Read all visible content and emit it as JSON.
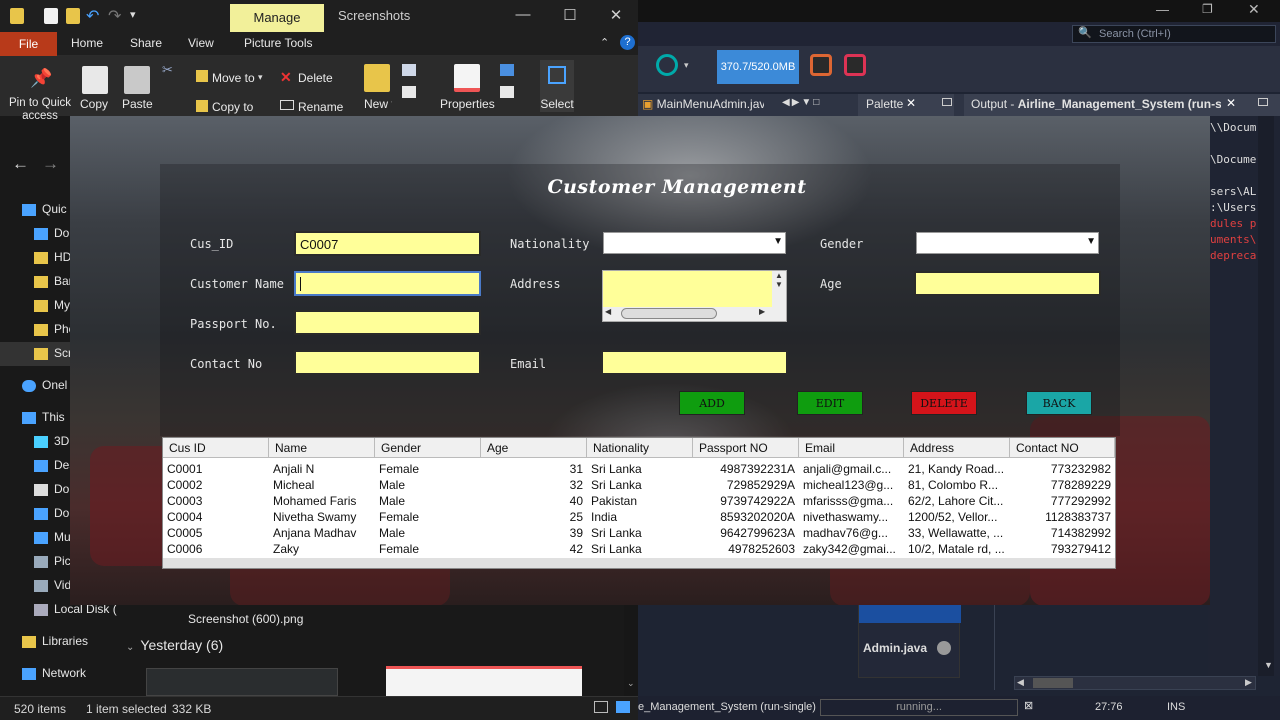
{
  "explorer": {
    "manage_tab": "Manage",
    "title": "Screenshots",
    "ribbon_tabs": [
      "File",
      "Home",
      "Share",
      "View",
      "Picture Tools"
    ],
    "ribbon": {
      "pin": "Pin to Quick access",
      "copy": "Copy",
      "paste": "Paste",
      "move_to": "Move to",
      "delete": "Delete",
      "copy_to": "Copy to",
      "rename": "Rename",
      "new_folder": "New folder",
      "properties": "Properties",
      "select": "Select"
    },
    "nav_items": [
      "Quic",
      "Do",
      "HD",
      "Bar",
      "My",
      "Pho",
      "Scr",
      "Onel",
      "This",
      "3D",
      "Des",
      "Do",
      "Do",
      "Mu",
      "Pic",
      "Vid",
      "Local Disk ("
    ],
    "libraries": "Libraries",
    "network": "Network",
    "file_name": "Screenshot (600).png",
    "group_yesterday": "Yesterday (6)",
    "status": {
      "items": "520 items",
      "selected": "1 item selected",
      "size": "332 KB"
    }
  },
  "ide": {
    "search_placeholder": "Search (Ctrl+I)",
    "memory": "370.7/520.0MB",
    "tab_file": "MainMenuAdmin.java...",
    "tab_palette": "Palette",
    "tab_output_prefix": "Output - ",
    "tab_output_name": "Airline_Management_System (run-s...",
    "output_lines": [
      "\\\\Docum",
      "\\Docume",
      "sers\\AL",
      ":\\Users",
      "dules p",
      "uments\\",
      "depreca"
    ],
    "palette_item": "Admin.java",
    "status_task": "e_Management_System (run-single)",
    "status_running": "running...",
    "status_pos": "27:76",
    "status_mode": "INS"
  },
  "cm": {
    "title": "Customer Management",
    "labels": {
      "cus_id": "Cus_ID",
      "customer_name": "Customer Name",
      "passport": "Passport No.",
      "contact": "Contact No",
      "nationality": "Nationality",
      "address": "Address",
      "email": "Email",
      "gender": "Gender",
      "age": "Age"
    },
    "values": {
      "cus_id": "C0007"
    },
    "buttons": {
      "add": "ADD",
      "edit": "EDIT",
      "delete": "DELETE",
      "back": "BACK"
    },
    "colors": {
      "add": "#0f9d0f",
      "edit": "#0f9d0f",
      "delete": "#d4141a",
      "back": "#1aa6a6",
      "field": "#ffff99"
    },
    "table": {
      "headers": [
        "Cus ID",
        "Name",
        "Gender",
        "Age",
        "Nationality",
        "Passport NO",
        "Email",
        "Address",
        "Contact NO"
      ],
      "rows": [
        [
          "C0001",
          "Anjali N",
          "Female",
          "31",
          "Sri Lanka",
          "4987392231A",
          "anjali@gmail.c...",
          "21, Kandy Road...",
          "773232982"
        ],
        [
          "C0002",
          "Micheal",
          "Male",
          "32",
          "Sri Lanka",
          "729852929A",
          "micheal123@g...",
          "81, Colombo R...",
          "778289229"
        ],
        [
          "C0003",
          "Mohamed Faris",
          "Male",
          "40",
          "Pakistan",
          "9739742922A",
          "mfarisss@gma...",
          "62/2, Lahore Cit...",
          "777292992"
        ],
        [
          "C0004",
          "Nivetha Swamy",
          "Female",
          "25",
          "India",
          "8593202020A",
          "nivethaswamy...",
          "1200/52, Vellor...",
          "1128383737"
        ],
        [
          "C0005",
          "Anjana Madhav",
          "Male",
          "39",
          "Sri Lanka",
          "9642799623A",
          "madhav76@g...",
          "33, Wellawatte, ...",
          "714382992"
        ],
        [
          "C0006",
          "Zaky",
          "Female",
          "42",
          "Sri Lanka",
          "4978252603",
          "zaky342@gmai...",
          "10/2, Matale rd, ...",
          "793279412"
        ]
      ]
    }
  }
}
